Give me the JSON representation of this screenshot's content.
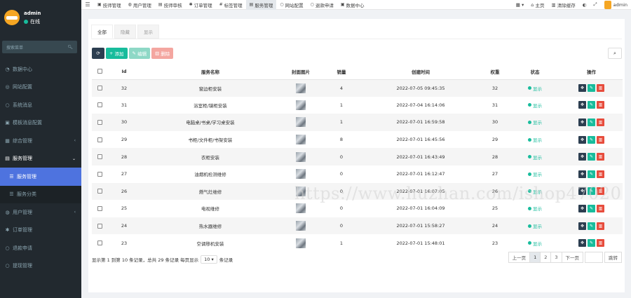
{
  "user": {
    "name": "admin",
    "status": "在线"
  },
  "sidebar": {
    "search_placeholder": "搜索菜单",
    "items": [
      {
        "label": "数据中心",
        "icon": "dashboard-icon"
      },
      {
        "label": "网站配置",
        "icon": "globe-icon"
      },
      {
        "label": "系统消息",
        "icon": "circle-icon"
      },
      {
        "label": "模板消息配置",
        "icon": "template-icon"
      },
      {
        "label": "综合管理",
        "icon": "grid-icon"
      },
      {
        "label": "服务管理",
        "icon": "briefcase-icon"
      },
      {
        "label": "服务管理",
        "icon": "list-icon"
      },
      {
        "label": "服务分类",
        "icon": "list-icon"
      },
      {
        "label": "用户管理",
        "icon": "user-icon"
      },
      {
        "label": "订单管理",
        "icon": "cart-icon"
      },
      {
        "label": "退款申请",
        "icon": "refund-icon"
      },
      {
        "label": "提现管理",
        "icon": "wallet-icon"
      }
    ]
  },
  "topnav": {
    "tabs": [
      {
        "label": "技师管理",
        "icon": "technician-icon"
      },
      {
        "label": "用户管理",
        "icon": "users-icon"
      },
      {
        "label": "技师审核",
        "icon": "audit-icon"
      },
      {
        "label": "订单管理",
        "icon": "cart-icon"
      },
      {
        "label": "标签管理",
        "icon": "hash-icon"
      },
      {
        "label": "服务管理",
        "icon": "briefcase-icon"
      },
      {
        "label": "网站配置",
        "icon": "globe-icon"
      },
      {
        "label": "退款申请",
        "icon": "refund-icon"
      },
      {
        "label": "数据中心",
        "icon": "dashboard-icon"
      }
    ],
    "home": "主页",
    "clear_cache": "清除缓存",
    "admin": "admin"
  },
  "content": {
    "tabs": [
      "全部",
      "隐藏",
      "显示"
    ],
    "toolbar": {
      "add": "添加",
      "edit": "编辑",
      "delete": "删除"
    },
    "columns": [
      "Id",
      "服务名称",
      "封面图片",
      "销量",
      "创建时间",
      "权重",
      "状态",
      "操作"
    ],
    "rows": [
      {
        "id": "32",
        "name": "窗边柜安装",
        "sales": "4",
        "created": "2022-07-05 09:45:35",
        "weight": "32",
        "status": "显示"
      },
      {
        "id": "31",
        "name": "浴室柜/镜柜安装",
        "sales": "1",
        "created": "2022-07-04 16:14:06",
        "weight": "31",
        "status": "显示"
      },
      {
        "id": "30",
        "name": "电脑桌/书桌/学习桌安装",
        "sales": "1",
        "created": "2022-07-01 16:59:58",
        "weight": "30",
        "status": "显示"
      },
      {
        "id": "29",
        "name": "书柜/文件柜/书架安装",
        "sales": "8",
        "created": "2022-07-01 16:45:56",
        "weight": "29",
        "status": "显示"
      },
      {
        "id": "28",
        "name": "衣柜安装",
        "sales": "0",
        "created": "2022-07-01 16:43:49",
        "weight": "28",
        "status": "显示"
      },
      {
        "id": "27",
        "name": "油烟机检测维修",
        "sales": "0",
        "created": "2022-07-01 16:12:47",
        "weight": "27",
        "status": "显示"
      },
      {
        "id": "26",
        "name": "燃气灶维修",
        "sales": "0",
        "created": "2022-07-01 16:07:05",
        "weight": "26",
        "status": "显示"
      },
      {
        "id": "25",
        "name": "电视维修",
        "sales": "0",
        "created": "2022-07-01 16:04:09",
        "weight": "25",
        "status": "显示"
      },
      {
        "id": "24",
        "name": "热水器维修",
        "sales": "0",
        "created": "2022-07-01 15:58:27",
        "weight": "24",
        "status": "显示"
      },
      {
        "id": "23",
        "name": "空调移机安装",
        "sales": "1",
        "created": "2022-07-01 15:48:01",
        "weight": "23",
        "status": "显示"
      }
    ],
    "footer": {
      "info": "显示第 1 到第 10 条记录，总共 29 条记录 每页显示",
      "page_size": "10",
      "suffix": "条记录"
    },
    "pager": {
      "prev": "上一页",
      "pages": [
        "1",
        "2",
        "3"
      ],
      "next": "下一页",
      "jump": "跳转"
    }
  },
  "watermark": "https://www.huzhan.com/ishop47020",
  "colors": {
    "sidebar_bg": "#22292f",
    "accent_blue": "#4e73df",
    "success": "#18bc9c",
    "danger": "#e74c3c",
    "dark": "#2c3e50"
  }
}
